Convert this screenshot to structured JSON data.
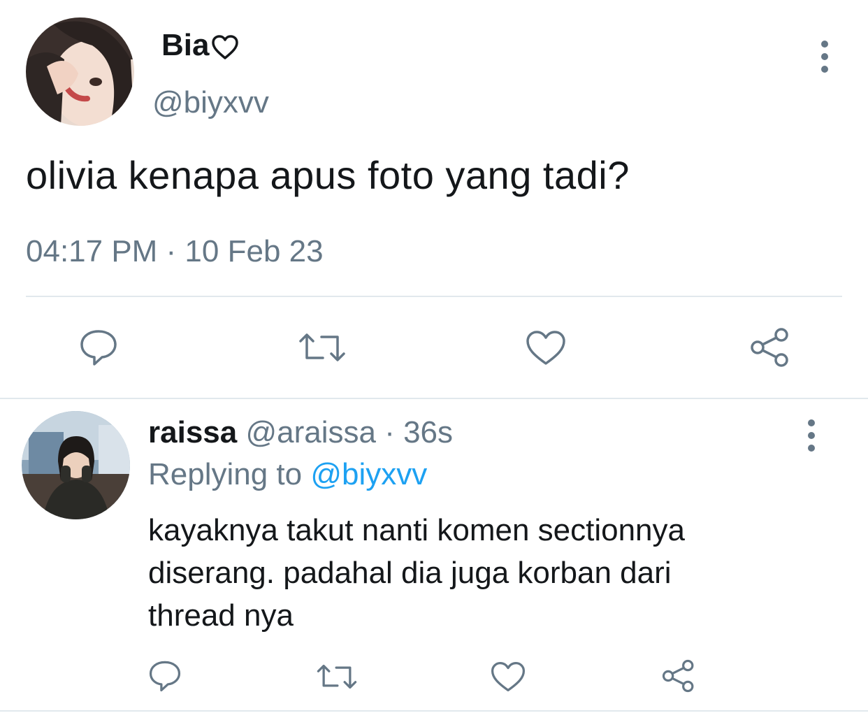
{
  "main_tweet": {
    "display_name": "Bia",
    "name_emoji_icon": "white-heart-icon",
    "handle": "@biyxvv",
    "text": "olivia kenapa apus foto yang tadi?",
    "timestamp": "04:17 PM · 10 Feb 23",
    "actions": [
      "reply-icon",
      "retweet-icon",
      "like-icon",
      "share-icon"
    ]
  },
  "reply_tweet": {
    "display_name": "raissa",
    "meta": "@araissa · 36s",
    "replying_label": "Replying to",
    "replying_handle": "@biyxvv",
    "text_lines": [
      "kayaknya takut nanti komen sectionnya",
      "diserang. padahal dia juga korban dari",
      "thread nya"
    ],
    "actions": [
      "reply-icon",
      "retweet-icon",
      "like-icon",
      "share-icon"
    ]
  },
  "colors": {
    "text_primary": "#14171a",
    "text_secondary": "#657786",
    "mention": "#1da1f2",
    "divider": "#e1e8ed"
  }
}
